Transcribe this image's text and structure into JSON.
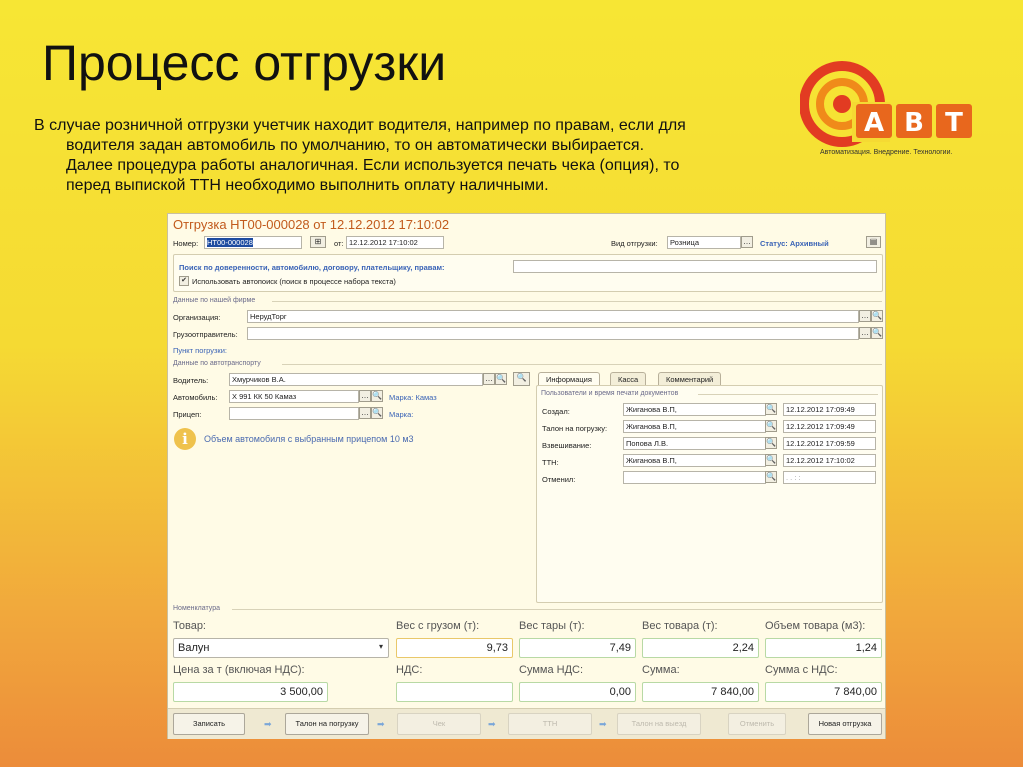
{
  "slide": {
    "title": "Процесс отгрузки",
    "text_line1": "В случае розничной отгрузки учетчик находит водителя, например по правам, если для",
    "text_line2": "водителя задан автомобиль по умолчанию, то он автоматически выбирается.",
    "text_line3": "Далее процедура работы аналогичная. Если используется печать чека (опция), то",
    "text_line4": "перед выпиской ТТН необходимо выполнить оплату наличными."
  },
  "logo": {
    "letters": "АВТ",
    "tagline": "Автоматизация. Внедрение. Технологии."
  },
  "window": {
    "title": "Отгрузка НТ00-000028 от 12.12.2012 17:10:02",
    "number_label": "Номер:",
    "number_value": "НТ00-000028",
    "date_label": "от:",
    "date_value": "12.12.2012 17:10:02",
    "shipment_type_label": "Вид отгрузки:",
    "shipment_type_value": "Розница",
    "status": "Статус: Архивный",
    "search_label": "Поиск по доверенности, автомобилю, договору, плательщику, правам:",
    "search_value": "",
    "autosearch_label": "Использовать автопоиск (поиск в процессе набора текста)",
    "autosearch_checked": true,
    "firm_section": "Данные по нашей фирме",
    "org_label": "Организация:",
    "org_value": "НерудТорг",
    "shipper_label": "Грузоотправитель:",
    "shipper_value": "",
    "loading_point_link": "Пункт погрузки:",
    "transport_section": "Данные по автотранспорту",
    "driver_label": "Водитель:",
    "driver_value": "Хмурчиков В.А.",
    "car_label": "Автомобиль:",
    "car_value": "Х 991 КК 50 Камаз",
    "car_brand": "Марка: Камаз",
    "trailer_label": "Прицеп:",
    "trailer_value": "",
    "trailer_brand": "Марка:",
    "info_message": "Объем автомобиля с выбранным прицепом 10 м3"
  },
  "tabs": [
    "Информация",
    "Касса",
    "Комментарий"
  ],
  "print_users": {
    "section": "Пользователи и время печати документов",
    "rows": [
      {
        "label": "Создал:",
        "user": "Жиганова В.П,",
        "time": "12.12.2012 17:09:49"
      },
      {
        "label": "Талон на погрузку:",
        "user": "Жиганова В.П,",
        "time": "12.12.2012 17:09:49"
      },
      {
        "label": "Взвешивание:",
        "user": "Попова Л.В.",
        "time": "12.12.2012 17:09:59"
      },
      {
        "label": "ТТН:",
        "user": "Жиганова В.П,",
        "time": "12.12.2012 17:10:02"
      },
      {
        "label": "Отменил:",
        "user": "",
        "time": " .  .      :  :"
      }
    ]
  },
  "nomenclature": {
    "section": "Номенклатура",
    "product_label": "Товар:",
    "product_value": "Валун",
    "gross_label": "Вес с грузом (т):",
    "gross_value": "9,73",
    "tare_label": "Вес тары (т):",
    "tare_value": "7,49",
    "net_label": "Вес товара (т):",
    "net_value": "2,24",
    "volume_label": "Объем товара (м3):",
    "volume_value": "1,24",
    "price_label": "Цена за т (включая НДС):",
    "price_value": "3 500,00",
    "vat_label": "НДС:",
    "vat_value": "",
    "vat_sum_label": "Сумма НДС:",
    "vat_sum_value": "0,00",
    "sum_label": "Сумма:",
    "sum_value": "7 840,00",
    "sum_vat_label": "Сумма с НДС:",
    "sum_vat_value": "7 840,00"
  },
  "footer": {
    "save": "Записать",
    "loading_ticket": "Талон на погрузку",
    "check": "Чек",
    "ttn": "ТТН",
    "exit_ticket": "Талон на выезд",
    "cancel": "Отменить",
    "new_shipment": "Новая отгрузка"
  }
}
